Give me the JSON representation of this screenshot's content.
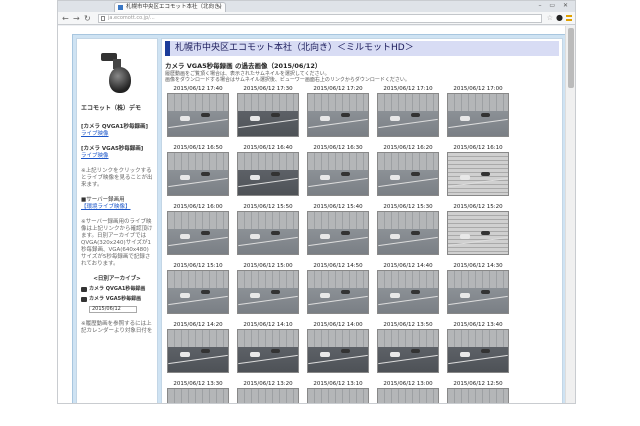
{
  "browser": {
    "tab_title": "札幌市中央区エコモット本社（北向き）",
    "url": "ja.ecomott.co.jp/...",
    "window_controls": "– ▭ ✕"
  },
  "sidebar": {
    "site_title": "エコモット（株）デモ",
    "cam1_label": "[カメラ QVGA1秒毎録画]",
    "cam1_link": "ライブ映像",
    "cam2_label": "[カメラ VGA5秒毎録画]",
    "cam2_link": "ライブ映像",
    "note1": "※上記リンクをクリックするとライブ映像を見ることが出来ます。",
    "server_label": "■サーバー録画用",
    "server_link": "【環境ライブ映像】",
    "note2": "※サーバー録画用のライブ映像は上記リンクから確認頂けます。日別アーカイブでは QVGA(320x240)サイズが1秒毎録画、VGA(640x480)サイズが5秒毎録画で記録されております。",
    "archive_heading": "<日別アーカイブ>",
    "archive_cam1": "カメラ QVGA1秒毎録画",
    "archive_cam2": "カメラ VGA5秒毎録画",
    "archive_date": "2015/06/12",
    "note3": "※履歴動画を参照するには上記カレンダーより対象日付を"
  },
  "main": {
    "title": "札幌市中央区エコモット本社（北向き）＜ミルモットHD＞",
    "subtitle": "カメラ VGA5秒毎録画 の過去画像（2015/06/12）",
    "note1": "履歴動画をご覧頂く場合は、表示されたサムネイルを選択してください。",
    "note2": "画像をダウンロードする場合はサムネイル選択後、ビューワー画面右上のリンクからダウンロードください。",
    "thumbnails": [
      {
        "time": "2015/06/12 17:40"
      },
      {
        "time": "2015/06/12 17:30"
      },
      {
        "time": "2015/06/12 17:20"
      },
      {
        "time": "2015/06/12 17:10"
      },
      {
        "time": "2015/06/12 17:00"
      },
      {
        "time": "2015/06/12 16:50"
      },
      {
        "time": "2015/06/12 16:40"
      },
      {
        "time": "2015/06/12 16:30"
      },
      {
        "time": "2015/06/12 16:20"
      },
      {
        "time": "2015/06/12 16:10"
      },
      {
        "time": "2015/06/12 16:00"
      },
      {
        "time": "2015/06/12 15:50"
      },
      {
        "time": "2015/06/12 15:40"
      },
      {
        "time": "2015/06/12 15:30"
      },
      {
        "time": "2015/06/12 15:20"
      },
      {
        "time": "2015/06/12 15:10"
      },
      {
        "time": "2015/06/12 15:00"
      },
      {
        "time": "2015/06/12 14:50"
      },
      {
        "time": "2015/06/12 14:40"
      },
      {
        "time": "2015/06/12 14:30"
      },
      {
        "time": "2015/06/12 14:20"
      },
      {
        "time": "2015/06/12 14:10"
      },
      {
        "time": "2015/06/12 14:00"
      },
      {
        "time": "2015/06/12 13:50"
      },
      {
        "time": "2015/06/12 13:40"
      },
      {
        "time": "2015/06/12 13:30"
      },
      {
        "time": "2015/06/12 13:20"
      },
      {
        "time": "2015/06/12 13:10"
      },
      {
        "time": "2015/06/12 13:00"
      },
      {
        "time": "2015/06/12 12:50"
      }
    ]
  }
}
